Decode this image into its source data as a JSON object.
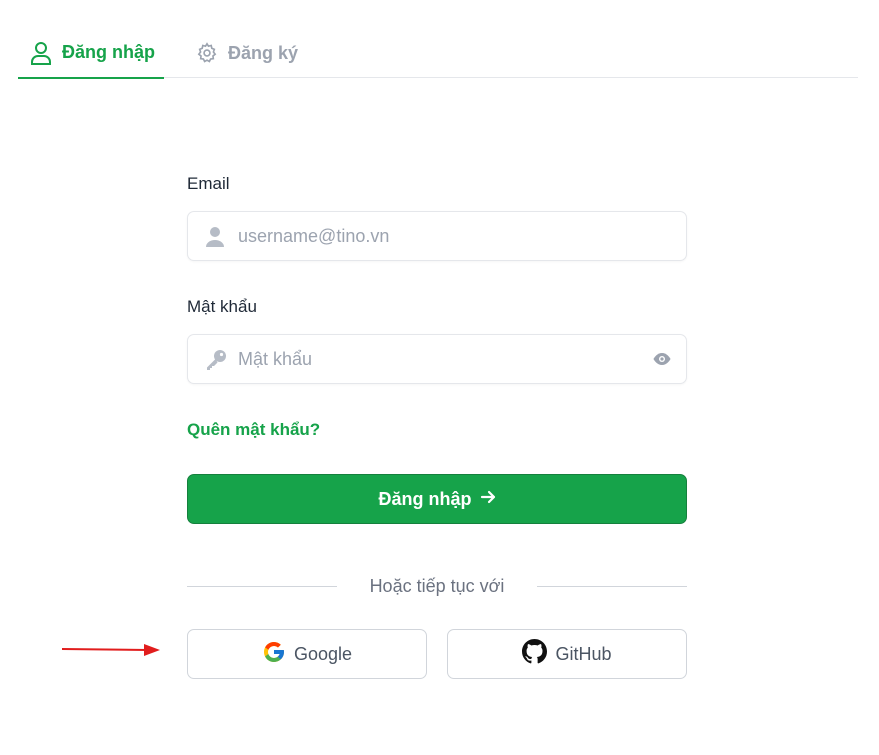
{
  "tabs": {
    "login": {
      "label": "Đăng nhập",
      "icon": "user-icon",
      "active": true
    },
    "register": {
      "label": "Đăng ký",
      "icon": "gear-icon",
      "active": false
    }
  },
  "form": {
    "email_label": "Email",
    "email_placeholder": "username@tino.vn",
    "password_label": "Mật khẩu",
    "password_placeholder": "Mật khẩu",
    "forgot_link": "Quên mật khẩu?",
    "submit_label": "Đăng nhập",
    "divider_text": "Hoặc tiếp tục với"
  },
  "social": {
    "google_label": "Google",
    "github_label": "GitHub"
  },
  "colors": {
    "accent": "#16a34a",
    "muted": "#9ca3af",
    "annotation_arrow": "#e11d1d"
  }
}
